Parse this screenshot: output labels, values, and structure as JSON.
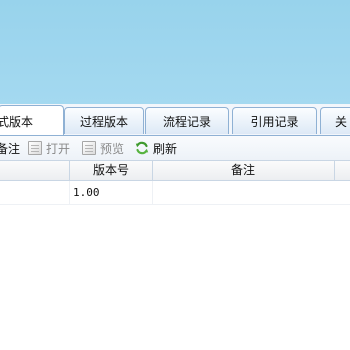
{
  "tabs": [
    {
      "label": "式版本",
      "active": true
    },
    {
      "label": "过程版本",
      "active": false
    },
    {
      "label": "流程记录",
      "active": false
    },
    {
      "label": "引用记录",
      "active": false
    },
    {
      "label": "关",
      "active": false
    }
  ],
  "toolbar": {
    "note_label": "备注",
    "open_label": "打开",
    "preview_label": "预览",
    "refresh_label": "刷新"
  },
  "grid": {
    "columns": [
      "版本号",
      "备注"
    ],
    "rows": [
      {
        "version": "1.00",
        "note": ""
      }
    ]
  },
  "colors": {
    "banner": "#a4d9f0",
    "tab_border": "#8fb1d4",
    "refresh_green": "#3f9a2e"
  },
  "icons": {
    "open": "document-icon",
    "preview": "document-icon",
    "refresh": "refresh-icon"
  }
}
